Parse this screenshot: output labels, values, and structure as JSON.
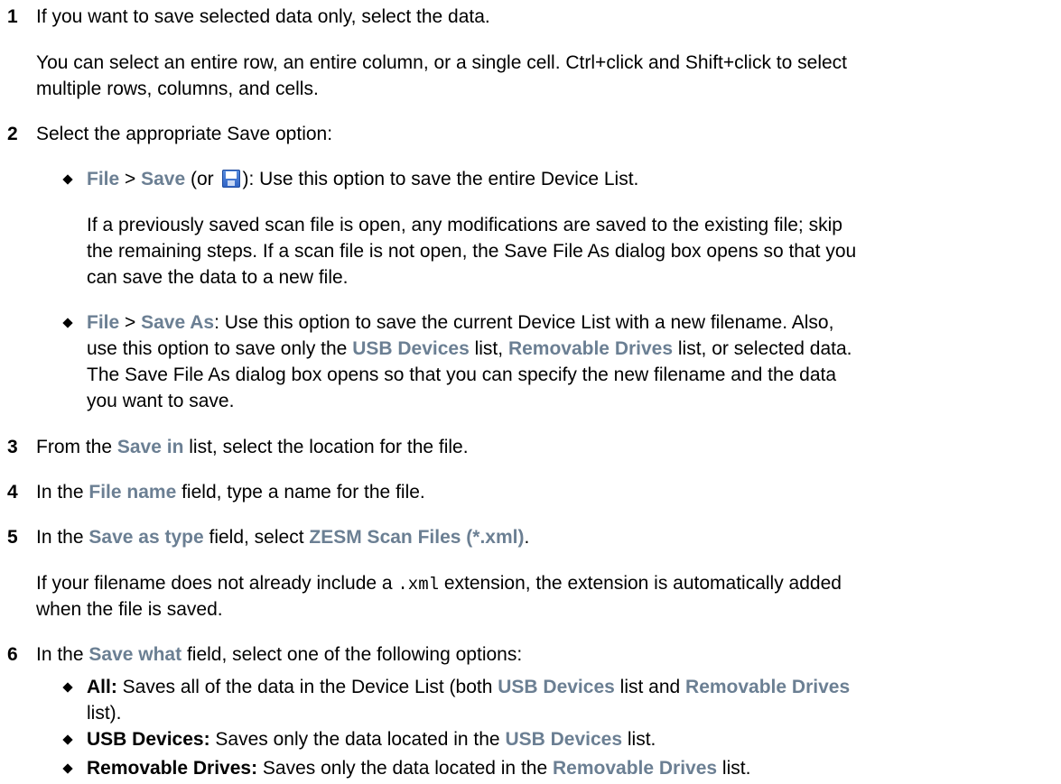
{
  "step1": {
    "number": "1",
    "text": "If you want to save selected data only, select the data.",
    "para_line1": "You can select an entire row, an entire column, or a single cell. Ctrl+click and Shift+click to select",
    "para_line2": "multiple rows, columns, and cells."
  },
  "step2": {
    "number": "2",
    "text": "Select the appropriate Save option:",
    "bullet1": {
      "menu": "File",
      "sep": " > ",
      "cmd": "Save",
      "pre_icon": " (or ",
      "post_icon": "): Use this option to save the entire Device List.",
      "icon": "save-icon",
      "para_line1": "If a previously saved scan file is open, any modifications are saved to the existing file; skip",
      "para_line2": "the remaining steps. If a scan file is not open, the Save File As dialog box opens so that you",
      "para_line3": "can save the data to a new file."
    },
    "bullet2": {
      "menu": "File",
      "sep": " > ",
      "cmd": "Save As",
      "line1_rest": ": Use this option to save the current Device List with a new filename. Also,",
      "line2_a": "use this option to save only the ",
      "usb": "USB Devices",
      "line2_b": " list, ",
      "removable": "Removable Drives",
      "line2_c": " list, or selected data.",
      "line3": "The Save File As dialog box opens so that you can specify the new filename and the data",
      "line4": "you want to save."
    }
  },
  "step3": {
    "number": "3",
    "a": "From the ",
    "ui": "Save in",
    "b": " list, select the location for the file."
  },
  "step4": {
    "number": "4",
    "a": "In the ",
    "ui": "File name",
    "b": " field, type a name for the file."
  },
  "step5": {
    "number": "5",
    "a": "In the ",
    "ui": "Save as type",
    "b": " field, select ",
    "ui2": "ZESM Scan Files (*.xml)",
    "c": ".",
    "para_a": "If your filename does not already include a ",
    "code": ".xml",
    "para_b": " extension, the extension is automatically added",
    "para_line2": "when the file is saved."
  },
  "step6": {
    "number": "6",
    "a": "In the ",
    "ui": "Save what",
    "b": " field, select one of the following options:",
    "opt_all": {
      "label": "All:",
      "a": " Saves all of the data in the Device List (both ",
      "usb": "USB Devices",
      "b": " list and ",
      "removable": "Removable Drives",
      "line2": "list)."
    },
    "opt_usb": {
      "label": "USB Devices:",
      "a": " Saves only the data located in the ",
      "ui": "USB Devices",
      "b": " list."
    },
    "opt_removable": {
      "label": "Removable Drives:",
      "a": " Saves only the data located in the ",
      "ui": "Removable Drives",
      "b": " list."
    }
  }
}
